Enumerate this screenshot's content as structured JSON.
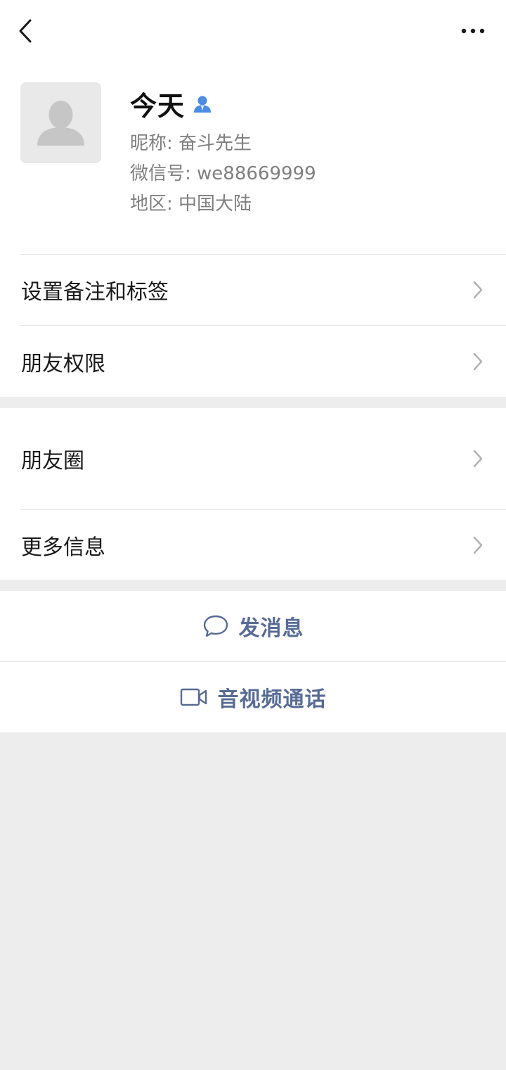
{
  "header": {
    "back_icon": "chevron-left-icon",
    "more_icon": "more-dots-icon"
  },
  "profile": {
    "name": "今天",
    "nickname_label": "昵称:",
    "nickname": "奋斗先生",
    "wechat_id_label": "微信号:",
    "wechat_id": "we88669999",
    "region_label": "地区:",
    "region": "中国大陆"
  },
  "menu": {
    "remark_label": "设置备注和标签",
    "permission_label": "朋友权限",
    "moments_label": "朋友圈",
    "more_info_label": "更多信息"
  },
  "actions": {
    "message_label": "发消息",
    "call_label": "音视频通话"
  },
  "colors": {
    "link": "#576b95",
    "background": "#ededed",
    "contact_badge": "#4a8ce8"
  }
}
